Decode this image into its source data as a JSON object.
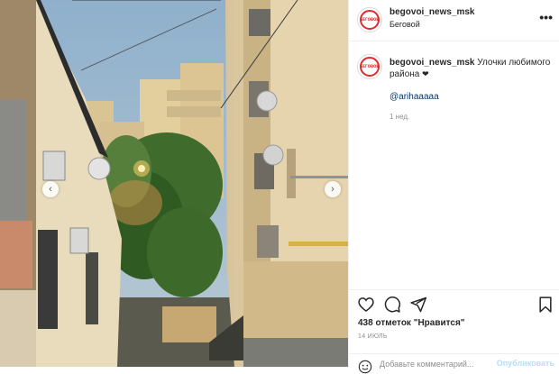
{
  "post": {
    "username": "begovoi_news_msk",
    "location": "Беговой",
    "avatar_text": "БЕГОВОЙ",
    "caption": "Улочки любимого района",
    "caption_heart": "❤",
    "mention": "@arihaaaaa",
    "time_ago": "1 нед.",
    "likes": "438 отметок \"Нравится\"",
    "date": "14 ИЮЛЬ",
    "comment_placeholder": "Добавьте комментарий...",
    "post_button": "Опубликовать"
  },
  "icons": {
    "more": "more-options-icon",
    "like": "heart-icon",
    "comment": "comment-icon",
    "share": "share-icon",
    "save": "bookmark-icon",
    "emoji": "emoji-icon",
    "prev": "chevron-left-icon",
    "next": "chevron-right-icon"
  },
  "colors": {
    "brand_red": "#e02b2b",
    "link": "#00376b",
    "muted": "#8e8e8e",
    "post_button": "#b2dffc"
  }
}
